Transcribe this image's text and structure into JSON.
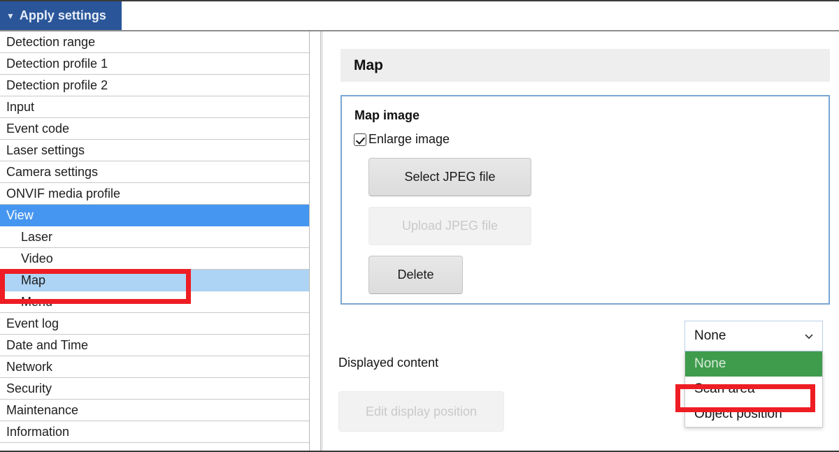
{
  "topbar": {
    "apply_settings_label": "Apply settings",
    "caret_icon": "triangle-down-icon"
  },
  "sidebar": {
    "items": [
      {
        "label": "Detection range",
        "indent": false,
        "state": "normal"
      },
      {
        "label": "Detection profile 1",
        "indent": false,
        "state": "normal"
      },
      {
        "label": "Detection profile 2",
        "indent": false,
        "state": "normal"
      },
      {
        "label": "Input",
        "indent": false,
        "state": "normal"
      },
      {
        "label": "Event code",
        "indent": false,
        "state": "normal"
      },
      {
        "label": "Laser settings",
        "indent": false,
        "state": "normal"
      },
      {
        "label": "Camera settings",
        "indent": false,
        "state": "normal"
      },
      {
        "label": "ONVIF media profile",
        "indent": false,
        "state": "normal"
      },
      {
        "label": "View",
        "indent": false,
        "state": "selected-strong"
      },
      {
        "label": "Laser",
        "indent": true,
        "state": "normal"
      },
      {
        "label": "Video",
        "indent": true,
        "state": "normal"
      },
      {
        "label": "Map",
        "indent": true,
        "state": "selected-light"
      },
      {
        "label": "Menu",
        "indent": true,
        "state": "normal"
      },
      {
        "label": "Event log",
        "indent": false,
        "state": "normal"
      },
      {
        "label": "Date and Time",
        "indent": false,
        "state": "normal"
      },
      {
        "label": "Network",
        "indent": false,
        "state": "normal"
      },
      {
        "label": "Security",
        "indent": false,
        "state": "normal"
      },
      {
        "label": "Maintenance",
        "indent": false,
        "state": "normal"
      },
      {
        "label": "Information",
        "indent": false,
        "state": "normal"
      }
    ]
  },
  "content": {
    "section_title": "Map",
    "map_image_group": {
      "legend": "Map image",
      "enlarge_checkbox_label": "Enlarge image",
      "enlarge_checked": true,
      "select_jpeg_label": "Select JPEG file",
      "upload_jpeg_label": "Upload JPEG file",
      "upload_jpeg_disabled": true,
      "delete_label": "Delete"
    },
    "displayed_content": {
      "label": "Displayed content",
      "selected_value": "None",
      "chevron_icon": "chevron-down-icon",
      "options": [
        {
          "label": "None",
          "highlighted": true
        },
        {
          "label": "Scan area",
          "highlighted": false
        },
        {
          "label": "Object position",
          "highlighted": false
        }
      ]
    },
    "edit_display_position_label": "Edit display position",
    "edit_display_position_disabled": true
  },
  "annotations": {
    "color": "#ee1d24",
    "boxes": [
      {
        "target": "sidebar-item-map"
      },
      {
        "target": "option-object-position"
      }
    ]
  },
  "colors": {
    "apply_settings_bg": "#2a5699",
    "nav_selected_strong": "#4596f0",
    "nav_selected_light": "#aed4f5",
    "fieldset_border": "#7aa6d2",
    "option_highlight": "#3f9c4d",
    "annotation_red": "#ee1d24"
  }
}
